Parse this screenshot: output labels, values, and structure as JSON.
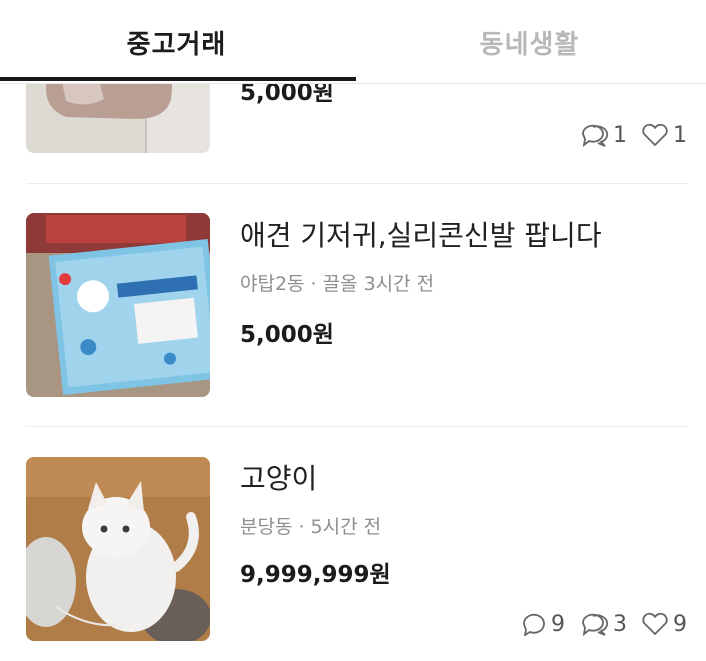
{
  "tabs": {
    "active": "중고거래",
    "inactive": "동네생활"
  },
  "items": [
    {
      "price": "5,000원",
      "chat_count": "1",
      "like_count": "1"
    },
    {
      "title": "애견 기저귀,실리콘신발 팝니다",
      "location": "야탑2동",
      "time": "끌올 3시간 전",
      "price": "5,000원"
    },
    {
      "title": "고양이",
      "location": "분당동",
      "time": "5시간 전",
      "price": "9,999,999원",
      "comment_count": "9",
      "chat_count": "3",
      "like_count": "9"
    }
  ],
  "meta_separator": "·",
  "icons": {
    "comment": "comment-icon",
    "chat": "chat-bubbles-icon",
    "like": "heart-icon"
  }
}
